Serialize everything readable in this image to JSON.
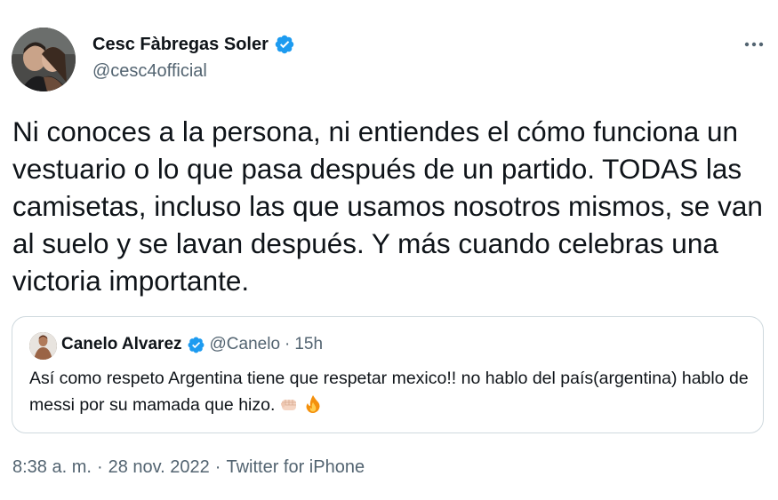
{
  "author": {
    "name": "Cesc Fàbregas Soler",
    "handle": "@cesc4official",
    "verified": true
  },
  "more_icon": "more-horizontal-icon",
  "tweet_text": "Ni conoces a la persona, ni entiendes el cómo funciona un vestuario o lo que pasa después de un partido. TODAS las camisetas, incluso las que usamos nosotros mismos, se van al suelo y se lavan después. Y más cuando celebras una victoria importante.",
  "quoted": {
    "name": "Canelo Alvarez",
    "handle": "@Canelo",
    "separator": "·",
    "time": "15h",
    "verified": true,
    "text": "Así como respeto Argentina tiene que respetar mexico!! no hablo del país(argentina) hablo de messi por su mamada que hizo.",
    "emojis": [
      "fist-icon",
      "fire-icon"
    ]
  },
  "meta": {
    "time": "8:38 a. m.",
    "sep1": "·",
    "date": "28 nov. 2022",
    "sep2": "·",
    "source": "Twitter for iPhone"
  },
  "colors": {
    "text": "#0f1419",
    "secondary": "#536471",
    "verified_blue": "#1d9bf0",
    "border": "#cfd9de"
  }
}
